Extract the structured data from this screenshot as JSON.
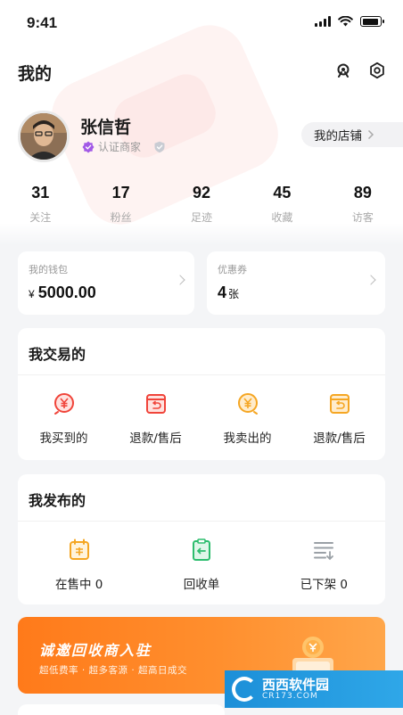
{
  "status_bar": {
    "time": "9:41",
    "battery_level": 0.9
  },
  "header": {
    "title": "我的",
    "icons": [
      "headset-icon",
      "settings-icon"
    ]
  },
  "profile": {
    "name": "张信哲",
    "certification": "认证商家",
    "shop_button": "我的店铺"
  },
  "stats": [
    {
      "value": "31",
      "label": "关注"
    },
    {
      "value": "17",
      "label": "粉丝"
    },
    {
      "value": "92",
      "label": "足迹"
    },
    {
      "value": "45",
      "label": "收藏"
    },
    {
      "value": "89",
      "label": "访客"
    }
  ],
  "wallet": {
    "label": "我的钱包",
    "currency": "¥",
    "amount": "5000.00"
  },
  "coupons": {
    "label": "优惠券",
    "count": "4",
    "unit": "张"
  },
  "trades": {
    "title": "我交易的",
    "items": [
      {
        "label": "我买到的",
        "icon": "yuan-circle-icon",
        "color": "#f0443a"
      },
      {
        "label": "退款/售后",
        "icon": "refund-box-icon",
        "color": "#f0443a"
      },
      {
        "label": "我卖出的",
        "icon": "yuan-circle-icon",
        "color": "#f5a623"
      },
      {
        "label": "退款/售后",
        "icon": "refund-box-icon",
        "color": "#f5a623"
      }
    ]
  },
  "posts": {
    "title": "我发布的",
    "items": [
      {
        "label": "在售中 0",
        "icon": "calendar-sale-icon",
        "color": "#f5a623"
      },
      {
        "label": "回收单",
        "icon": "clipboard-return-icon",
        "color": "#2dbd6e"
      },
      {
        "label": "已下架 0",
        "icon": "list-down-icon",
        "color": "#9aa0a6"
      }
    ]
  },
  "banner": {
    "title": "诚邀回收商入驻",
    "subtitle": "超低费率 · 超多客源 · 超高日成交"
  },
  "watermark": {
    "brand": "西西软件园",
    "url": "CR173.COM"
  }
}
